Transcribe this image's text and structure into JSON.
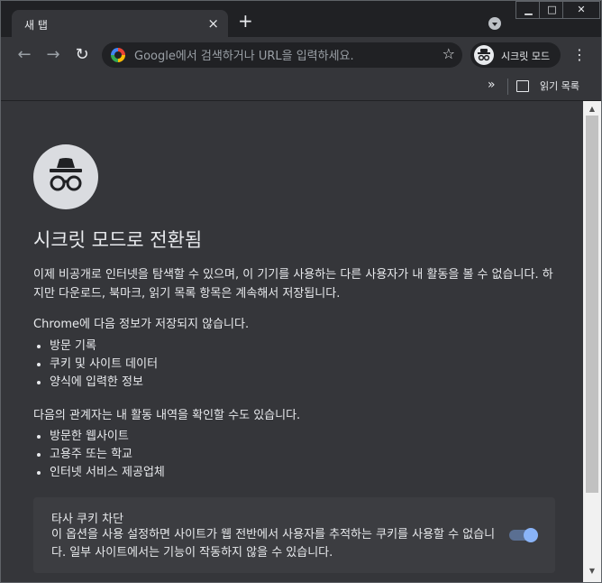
{
  "tab": {
    "title": "새 탭",
    "close_icon": "×",
    "new_tab_icon": "+"
  },
  "window": {
    "minimize": "▁",
    "maximize": "□",
    "close": "✕"
  },
  "toolbar": {
    "back_icon": "←",
    "forward_icon": "→",
    "reload_icon": "↻",
    "omnibox_placeholder": "Google에서 검색하거나 URL을 입력하세요.",
    "star_icon": "☆",
    "incognito_label": "시크릿 모드",
    "menu_icon": "⋮"
  },
  "bookmarks": {
    "more_icon": "»",
    "reading_list_label": "읽기 목록"
  },
  "content": {
    "heading": "시크릿 모드로 전환됨",
    "intro": "이제 비공개로 인터넷을 탐색할 수 있으며, 이 기기를 사용하는 다른 사용자가 내 활동을 볼 수 없습니다. 하지만 다운로드, 북마크, 읽기 목록 항목은 계속해서 저장됩니다.",
    "not_saved_heading": "Chrome에 다음 정보가 저장되지 않습니다.",
    "not_saved_items": [
      "방문 기록",
      "쿠키 및 사이트 데이터",
      "양식에 입력한 정보"
    ],
    "visible_heading": "다음의 관계자는 내 활동 내역을 확인할 수도 있습니다.",
    "visible_items": [
      "방문한 웹사이트",
      "고용주 또는 학교",
      "인터넷 서비스 제공업체"
    ],
    "cookie_title": "타사 쿠키 차단",
    "cookie_desc": "이 옵션을 사용 설정하면 사이트가 웹 전반에서 사용자를 추적하는 쿠키를 사용할 수 없습니다. 일부 사이트에서는 기능이 작동하지 않을 수 있습니다.",
    "cookie_toggle_on": true
  },
  "colors": {
    "accent": "#8ab4f8",
    "page_bg": "#35363a",
    "frame_bg": "#202124"
  }
}
